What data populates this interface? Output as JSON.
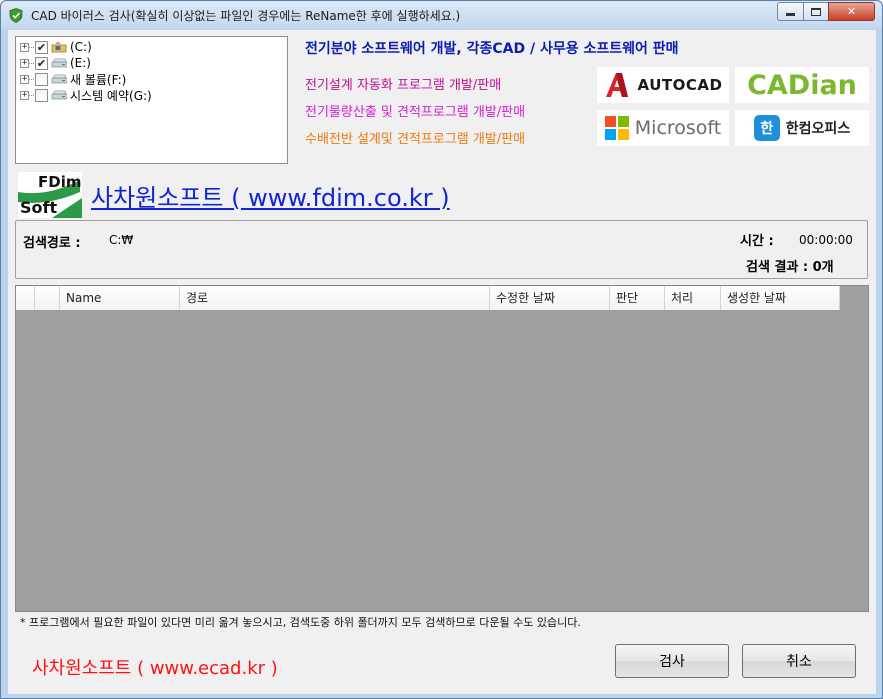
{
  "window": {
    "title": "CAD 바이러스 검사(확실히 이상없는 파일인 경우에는 ReName한 후에 실행하세요.)"
  },
  "tree": {
    "items": [
      {
        "label": "(C:)",
        "checked": true,
        "icon": "user-folder-icon"
      },
      {
        "label": "(E:)",
        "checked": true,
        "icon": "drive-icon"
      },
      {
        "label": "새 볼륨(F:)",
        "checked": false,
        "icon": "drive-icon"
      },
      {
        "label": "시스템 예약(G:)",
        "checked": false,
        "icon": "drive-icon"
      }
    ]
  },
  "ads": {
    "headline": "전기분야 소프트웨어 개발,  각종CAD / 사무용 소프트웨어 판매",
    "line1": "전기설계 자동화 프로그램 개발/판매",
    "line2": "전기물량산출 및 견적프로그램 개발/판매",
    "line3": "수배전반 설계및 견적프로그램 개발/판매",
    "logos": {
      "autocad": "AUTOCAD",
      "cadian": "CADian",
      "microsoft": "Microsoft",
      "hancom": "한컴오피스",
      "hancom_badge": "한"
    }
  },
  "brand": {
    "logo_top": "FDim",
    "logo_bottom": "Soft",
    "link_text": "사차원소프트 ( www.fdim.co.kr )"
  },
  "info": {
    "path_label": "검색경로 :",
    "path_value": "C:₩",
    "time_label": "시간 :",
    "time_value": "00:00:00",
    "result_label": "검색 결과 : 0개"
  },
  "list": {
    "columns": [
      "",
      "",
      "Name",
      "경로",
      "수정한 날짜",
      "판단",
      "처리",
      "생성한 날짜"
    ]
  },
  "footer": {
    "note": "* 프로그램에서 필요한 파일이 있다면 미리 옮겨 놓으시고,  검색도중 하위 폴더까지 모두 검색하므로 다운될 수도 있습니다.",
    "link_text": "사차원소프트 ( www.ecad.kr )",
    "search_button": "검사",
    "cancel_button": "취소"
  },
  "colors": {
    "headline": "#0a1db0",
    "ad1": "#c0108f",
    "ad2": "#d81dd8",
    "ad3": "#ee7a0f",
    "fdim_link": "#1125d6",
    "ecad_link": "#ff1212"
  }
}
